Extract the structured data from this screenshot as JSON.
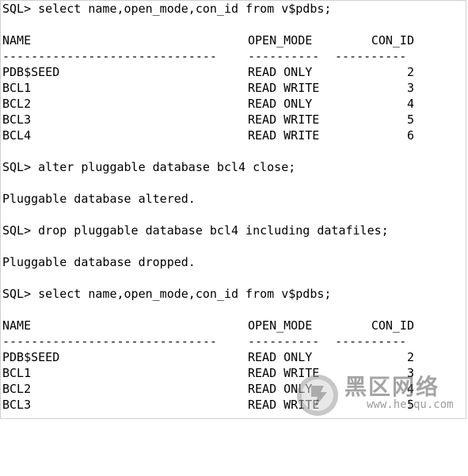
{
  "query1": {
    "prompt": "SQL> select name,open_mode,con_id from v$pdbs;",
    "headers": {
      "name": "NAME",
      "open_mode": "OPEN_MODE",
      "con_id": "CON_ID"
    },
    "dashes": {
      "name": "------------------------------",
      "open_mode": "----------",
      "con_id": "----------"
    },
    "rows": [
      {
        "name": "PDB$SEED",
        "open_mode": "READ ONLY",
        "con_id": "2"
      },
      {
        "name": "BCL1",
        "open_mode": "READ WRITE",
        "con_id": "3"
      },
      {
        "name": "BCL2",
        "open_mode": "READ ONLY",
        "con_id": "4"
      },
      {
        "name": "BCL3",
        "open_mode": "READ WRITE",
        "con_id": "5"
      },
      {
        "name": "BCL4",
        "open_mode": "READ WRITE",
        "con_id": "6"
      }
    ]
  },
  "alter_cmd": "SQL> alter pluggable database bcl4 close;",
  "alter_result": "Pluggable database altered.",
  "drop_cmd": "SQL> drop pluggable database bcl4 including datafiles;",
  "drop_result": "Pluggable database dropped.",
  "query2": {
    "prompt": "SQL> select name,open_mode,con_id from v$pdbs;",
    "headers": {
      "name": "NAME",
      "open_mode": "OPEN_MODE",
      "con_id": "CON_ID"
    },
    "dashes": {
      "name": "------------------------------",
      "open_mode": "----------",
      "con_id": "----------"
    },
    "rows": [
      {
        "name": "PDB$SEED",
        "open_mode": "READ ONLY",
        "con_id": "2"
      },
      {
        "name": "BCL1",
        "open_mode": "READ WRITE",
        "con_id": "3"
      },
      {
        "name": "BCL2",
        "open_mode": "READ ONLY",
        "con_id": "4"
      },
      {
        "name": "BCL3",
        "open_mode": "READ WRITE",
        "con_id": "5"
      }
    ]
  },
  "watermark": {
    "site_name": "黑区网络",
    "url": "www.heiqu.com"
  }
}
